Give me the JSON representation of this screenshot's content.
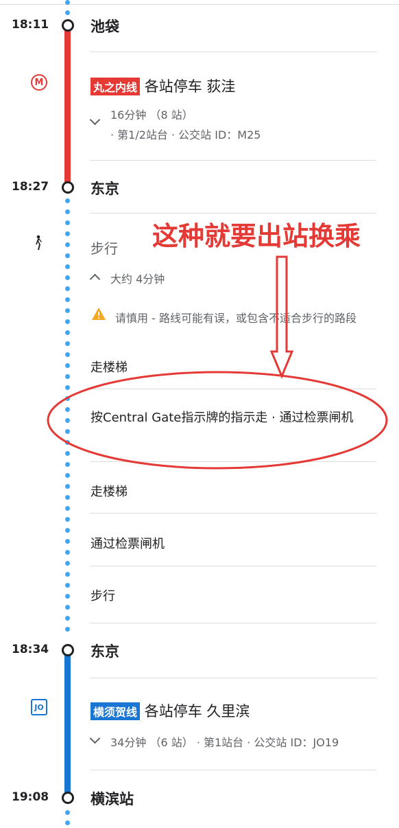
{
  "segments": {
    "s1": {
      "time": "18:11",
      "stop": "池袋"
    },
    "ride1": {
      "line_badge": "丸之内线",
      "line_color": "#e53935",
      "headline": "各站停车 荻洼",
      "duration": "16分钟 （8 站）",
      "detail": "· 第1/2站台 · 公交站 ID：M25"
    },
    "s2": {
      "time": "18:27",
      "stop": "东京"
    },
    "walk": {
      "mode": "步行",
      "duration": "大约 4分钟",
      "warning": "请慎用 - 路线可能有误，或包含不适合步行的路段"
    },
    "steps": [
      "走楼梯",
      "按Central Gate指示牌的指示走 · 通过检票闸机",
      "走楼梯",
      "通过检票闸机",
      "步行"
    ],
    "s3": {
      "time": "18:34",
      "stop": "东京"
    },
    "ride2": {
      "line_badge": "横须贺线",
      "line_color": "#1976d2",
      "icon_label": "JO",
      "headline": "各站停车 久里滨",
      "duration": "34分钟 （6 站）",
      "detail": "· 第1站台 · 公交站 ID：JO19"
    },
    "s4": {
      "time": "19:08",
      "stop": "横滨站"
    }
  },
  "annotation": {
    "text": "这种就要出站换乘",
    "color": "#e53935"
  }
}
